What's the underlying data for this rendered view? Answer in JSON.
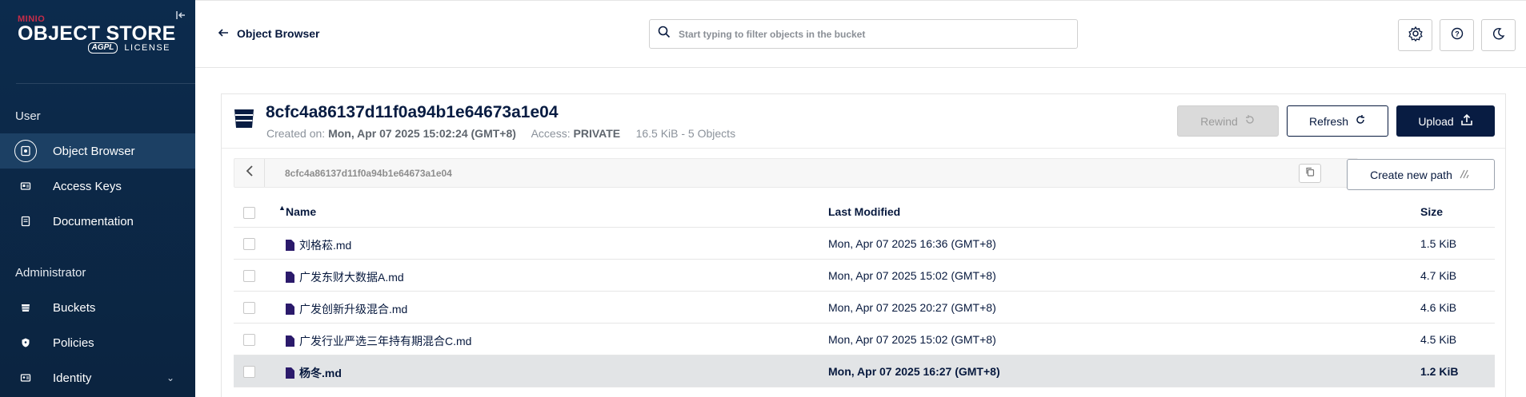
{
  "sidebar": {
    "logo": {
      "brand": "MINIO",
      "product": "OBJECT STORE",
      "license_badge": "AGPL",
      "license_text": "LICENSE"
    },
    "sections": [
      {
        "title": "User",
        "items": [
          {
            "label": "Object Browser",
            "icon": "object-browser-icon",
            "active": true
          },
          {
            "label": "Access Keys",
            "icon": "access-keys-icon"
          },
          {
            "label": "Documentation",
            "icon": "documentation-icon"
          }
        ]
      },
      {
        "title": "Administrator",
        "items": [
          {
            "label": "Buckets",
            "icon": "buckets-icon"
          },
          {
            "label": "Policies",
            "icon": "policies-icon"
          },
          {
            "label": "Identity",
            "icon": "identity-icon",
            "expandable": true
          }
        ]
      }
    ]
  },
  "topbar": {
    "back_label": "Object Browser",
    "search_placeholder": "Start typing to filter objects in the bucket",
    "buttons": [
      "settings-icon",
      "help-icon",
      "dark-mode-icon"
    ]
  },
  "bucket": {
    "name": "8cfc4a86137d11f0a94b1e64673a1e04",
    "created_label": "Created on:",
    "created_value": "Mon, Apr 07 2025 15:02:24 (GMT+8)",
    "access_label": "Access:",
    "access_value": "PRIVATE",
    "usage": "16.5 KiB - 5 Objects",
    "actions": {
      "rewind": "Rewind",
      "refresh": "Refresh",
      "upload": "Upload"
    }
  },
  "path": {
    "value": "8cfc4a86137d11f0a94b1e64673a1e04",
    "create_new_path": "Create new path"
  },
  "table": {
    "headers": {
      "name": "Name",
      "modified": "Last Modified",
      "size": "Size"
    },
    "rows": [
      {
        "name": "刘格菘.md",
        "modified": "Mon, Apr 07 2025 16:36 (GMT+8)",
        "size": "1.5 KiB"
      },
      {
        "name": "广发东财大数据A.md",
        "modified": "Mon, Apr 07 2025 15:02 (GMT+8)",
        "size": "4.7 KiB"
      },
      {
        "name": "广发创新升级混合.md",
        "modified": "Mon, Apr 07 2025 20:27 (GMT+8)",
        "size": "4.6 KiB"
      },
      {
        "name": "广发行业严选三年持有期混合C.md",
        "modified": "Mon, Apr 07 2025 15:02 (GMT+8)",
        "size": "4.5 KiB"
      },
      {
        "name": "杨冬.md",
        "modified": "Mon, Apr 07 2025 16:27 (GMT+8)",
        "size": "1.2 KiB",
        "selected": true
      }
    ]
  },
  "colors": {
    "sidebar_bg": "#0c2b4d",
    "accent": "#081c42",
    "brand_red": "#c72c48",
    "file_icon": "#2b1a6b"
  }
}
